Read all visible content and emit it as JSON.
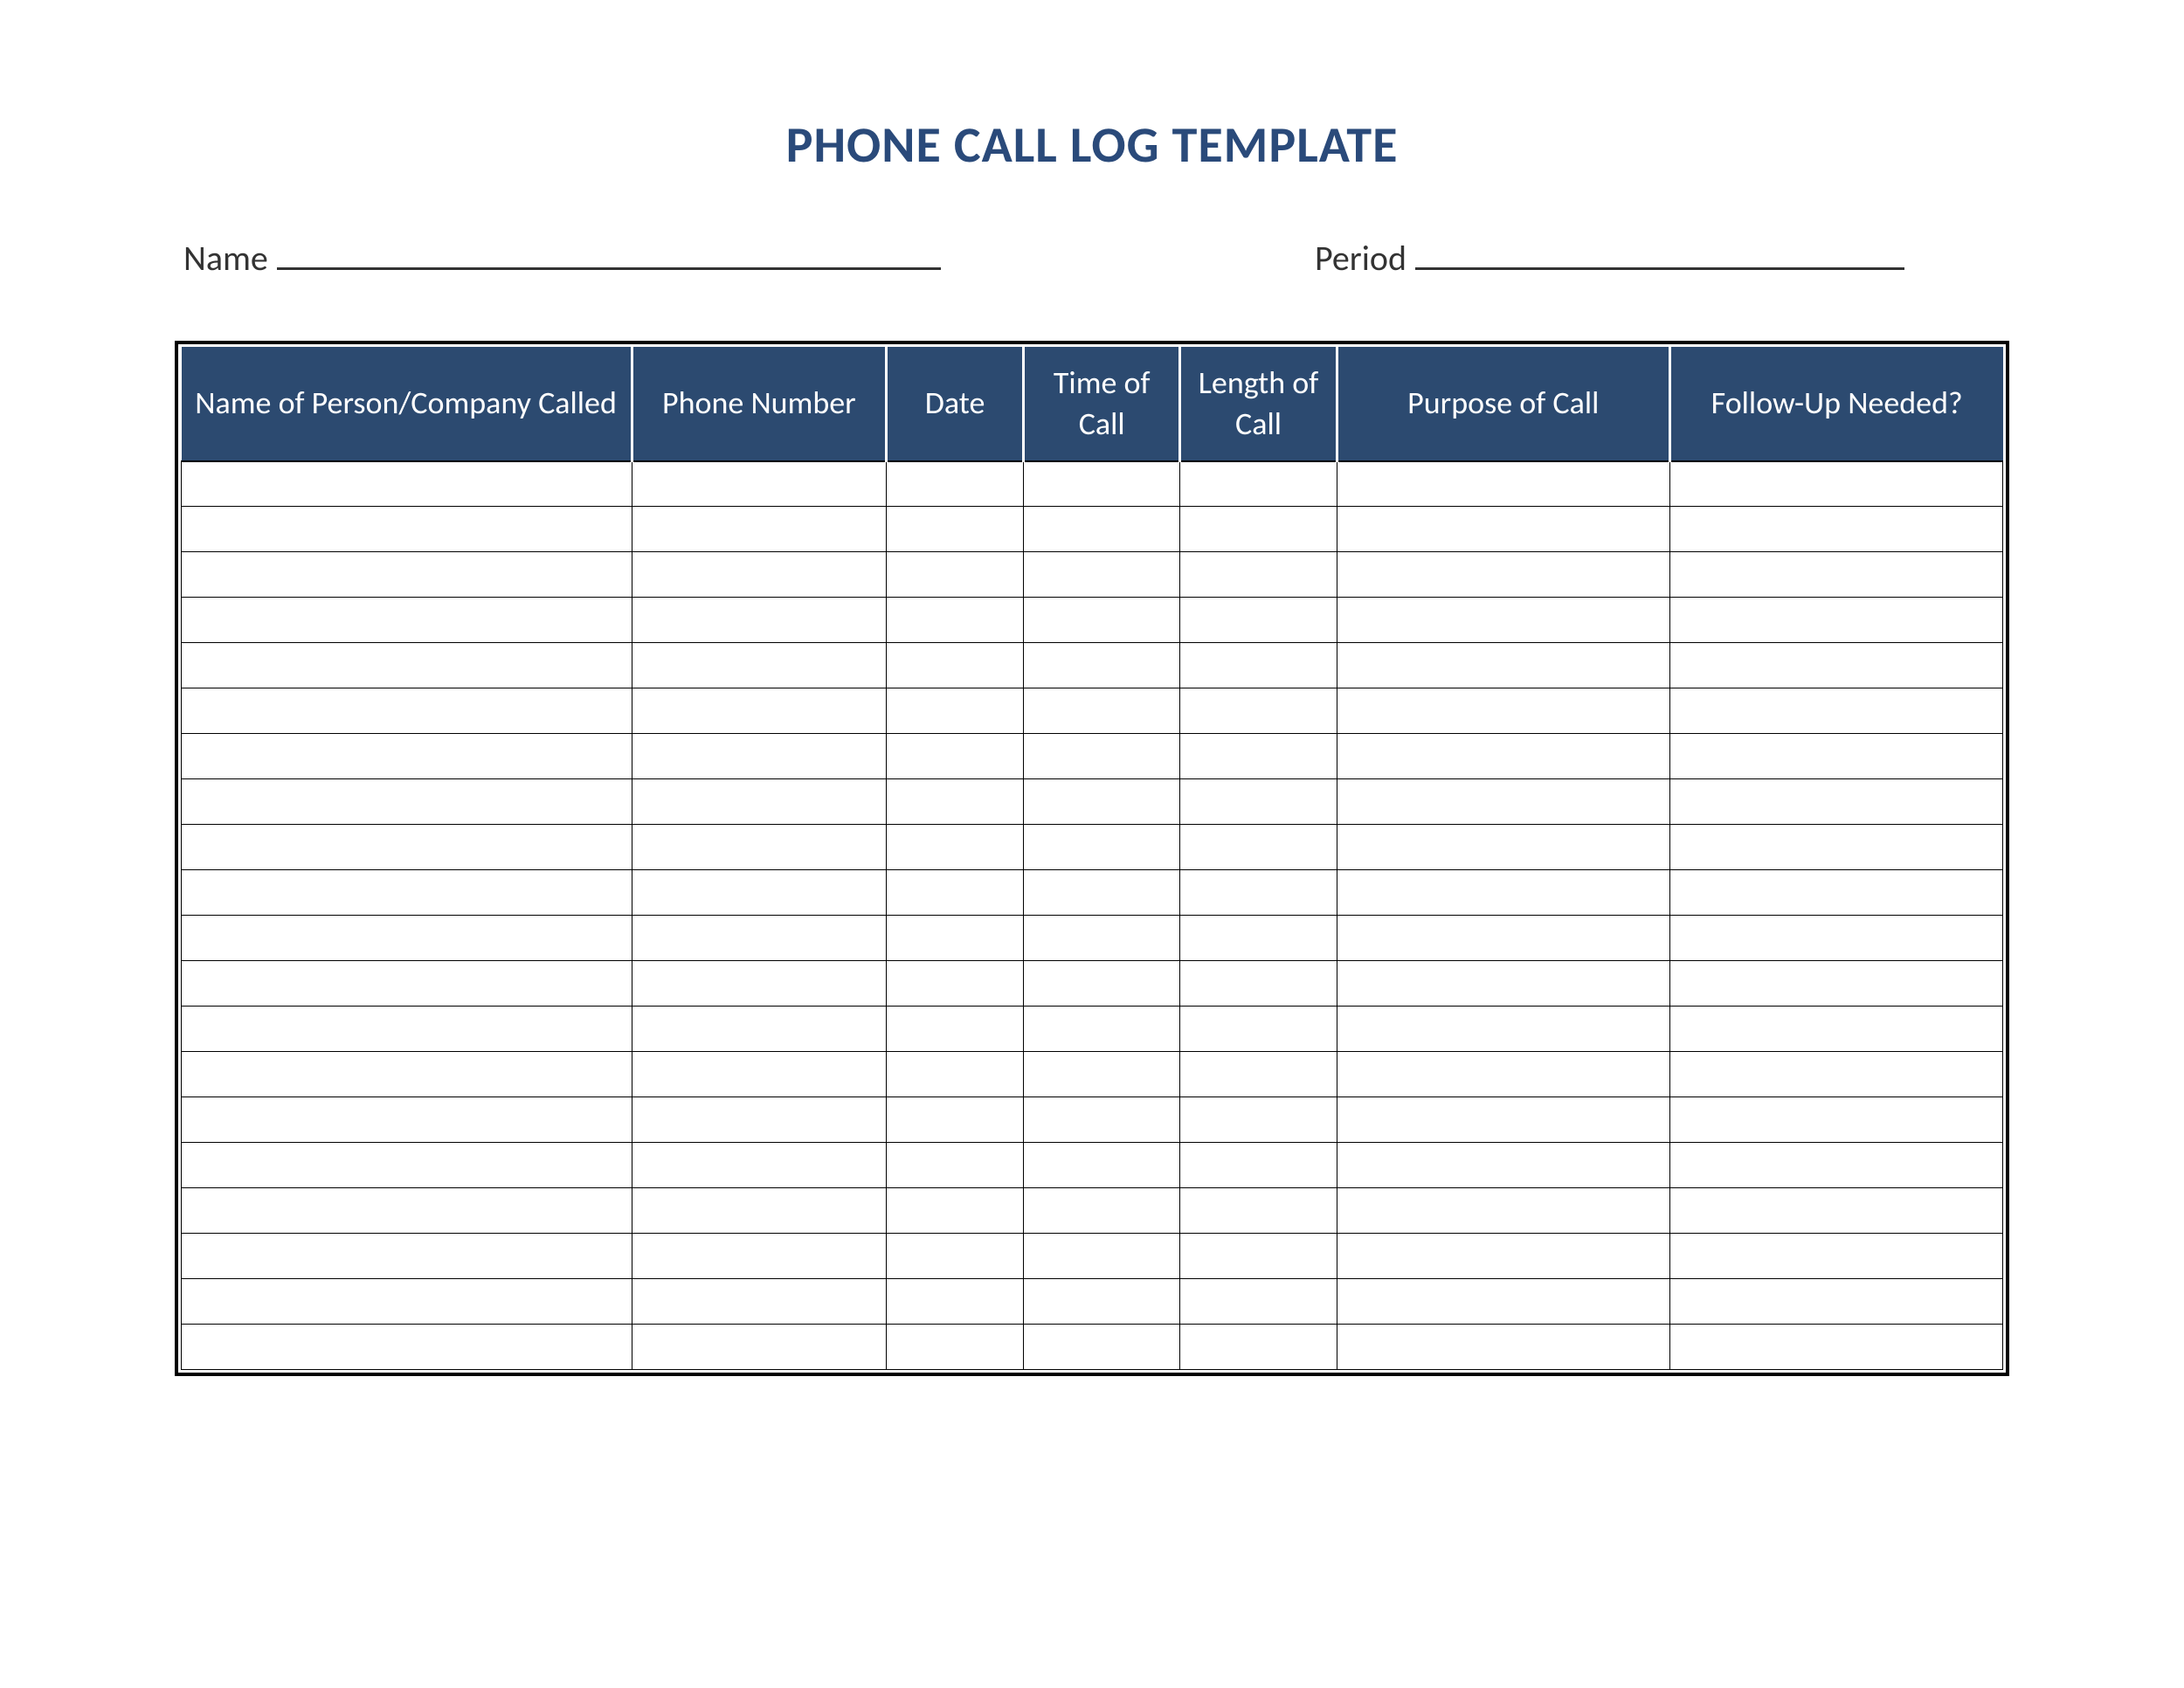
{
  "title": "PHONE CALL LOG TEMPLATE",
  "fields": {
    "name_label": "Name",
    "name_value": "",
    "period_label": "Period",
    "period_value": ""
  },
  "table": {
    "columns": [
      "Name of Person/Company Called",
      "Phone Number",
      "Date",
      "Time of Call",
      "Length of Call",
      "Purpose of Call",
      "Follow-Up Needed?"
    ],
    "row_count": 20,
    "rows": [
      [
        "",
        "",
        "",
        "",
        "",
        "",
        ""
      ],
      [
        "",
        "",
        "",
        "",
        "",
        "",
        ""
      ],
      [
        "",
        "",
        "",
        "",
        "",
        "",
        ""
      ],
      [
        "",
        "",
        "",
        "",
        "",
        "",
        ""
      ],
      [
        "",
        "",
        "",
        "",
        "",
        "",
        ""
      ],
      [
        "",
        "",
        "",
        "",
        "",
        "",
        ""
      ],
      [
        "",
        "",
        "",
        "",
        "",
        "",
        ""
      ],
      [
        "",
        "",
        "",
        "",
        "",
        "",
        ""
      ],
      [
        "",
        "",
        "",
        "",
        "",
        "",
        ""
      ],
      [
        "",
        "",
        "",
        "",
        "",
        "",
        ""
      ],
      [
        "",
        "",
        "",
        "",
        "",
        "",
        ""
      ],
      [
        "",
        "",
        "",
        "",
        "",
        "",
        ""
      ],
      [
        "",
        "",
        "",
        "",
        "",
        "",
        ""
      ],
      [
        "",
        "",
        "",
        "",
        "",
        "",
        ""
      ],
      [
        "",
        "",
        "",
        "",
        "",
        "",
        ""
      ],
      [
        "",
        "",
        "",
        "",
        "",
        "",
        ""
      ],
      [
        "",
        "",
        "",
        "",
        "",
        "",
        ""
      ],
      [
        "",
        "",
        "",
        "",
        "",
        "",
        ""
      ],
      [
        "",
        "",
        "",
        "",
        "",
        "",
        ""
      ],
      [
        "",
        "",
        "",
        "",
        "",
        "",
        ""
      ]
    ]
  },
  "colors": {
    "title_color": "#2a4a7a",
    "header_bg": "#2c4a70",
    "header_text": "#ffffff",
    "border": "#000000"
  }
}
